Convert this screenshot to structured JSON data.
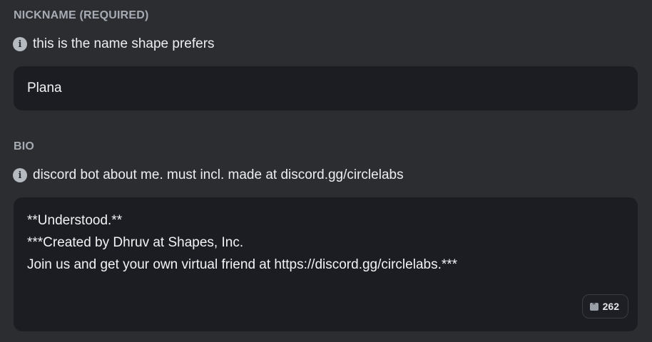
{
  "nickname": {
    "section_label": "NICKNAME (REQUIRED)",
    "hint": "this is the name shape prefers",
    "value": "Plana"
  },
  "bio": {
    "section_label": "BIO",
    "hint": "discord bot about me. must incl. made at discord.gg/circlelabs",
    "lines": [
      "**Understood.**",
      "***Created by Dhruv at Shapes, Inc.",
      "Join us and get your own virtual friend at https://discord.gg/circlelabs.***"
    ],
    "char_count": "262"
  },
  "icons": {
    "info": "info-icon",
    "counter": "quote-icon"
  }
}
